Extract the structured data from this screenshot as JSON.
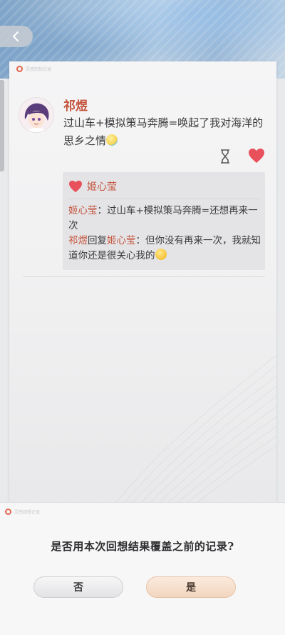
{
  "top_bar": {
    "back_icon": "chevron-left-icon"
  },
  "card": {
    "logo_text": "灵感回想记录",
    "post": {
      "author": "祁煜",
      "text": "过山车+模拟策马奔腾=唤起了我对海洋的思乡之情",
      "emoji": "smiling-face-emoji",
      "actions": [
        "hourglass-icon",
        "heart-icon"
      ]
    },
    "replies": {
      "liker": "姬心莹",
      "lines": [
        {
          "speaker": "姬心莹",
          "sep": "：",
          "text": "过山车+模拟策马奔腾=还想再来一次"
        },
        {
          "speaker": "祁煜",
          "mid": "回复",
          "target": "姬心莹",
          "sep": "：",
          "text": "但你没有再来一次，我就知道你还是很关心我的"
        }
      ]
    }
  },
  "dialog": {
    "logo_text": "灵感回想记录",
    "question": "是否用本次回想结果覆盖之前的记录?",
    "no_label": "否",
    "yes_label": "是"
  },
  "colors": {
    "accent_red": "#c4533c",
    "heart": "#e8505b"
  }
}
